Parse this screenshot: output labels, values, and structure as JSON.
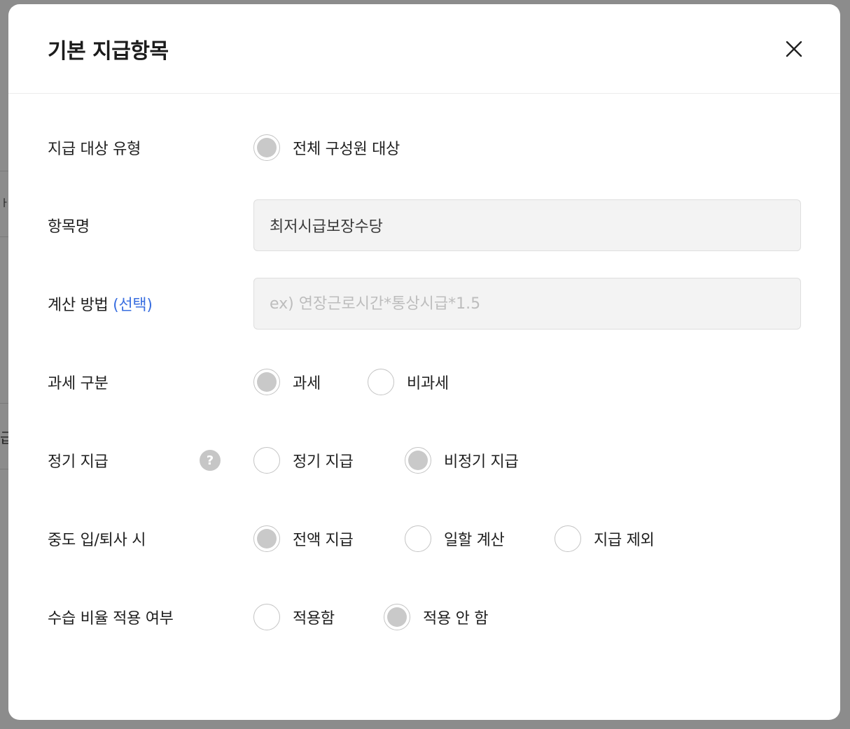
{
  "background": {
    "fragments": [
      "ㅏ",
      "급"
    ]
  },
  "modal": {
    "title": "기본 지급항목",
    "close_icon": "close-icon"
  },
  "form": {
    "target_type": {
      "label": "지급 대상 유형",
      "options": [
        {
          "label": "전체 구성원 대상",
          "selected": true
        }
      ]
    },
    "item_name": {
      "label": "항목명",
      "value": "최저시급보장수당"
    },
    "calc_method": {
      "label": "계산 방법",
      "label_suffix": "(선택)",
      "placeholder": "ex) 연장근로시간*통상시급*1.5",
      "value": ""
    },
    "tax_type": {
      "label": "과세 구분",
      "options": [
        {
          "label": "과세",
          "selected": true
        },
        {
          "label": "비과세",
          "selected": false
        }
      ]
    },
    "regular_payment": {
      "label": "정기 지급",
      "help_glyph": "?",
      "options": [
        {
          "label": "정기 지급",
          "selected": false
        },
        {
          "label": "비정기 지급",
          "selected": true
        }
      ]
    },
    "mid_join_leave": {
      "label": "중도 입/퇴사 시",
      "options": [
        {
          "label": "전액 지급",
          "selected": true
        },
        {
          "label": "일할 계산",
          "selected": false
        },
        {
          "label": "지급 제외",
          "selected": false
        }
      ]
    },
    "probation_ratio": {
      "label": "수습 비율 적용 여부",
      "options": [
        {
          "label": "적용함",
          "selected": false
        },
        {
          "label": "적용 안 함",
          "selected": true
        }
      ]
    }
  },
  "colors": {
    "accent": "#3a6fe0",
    "radio_selected_fill": "#c9c9c9",
    "overlay": "#8c8c8c"
  }
}
